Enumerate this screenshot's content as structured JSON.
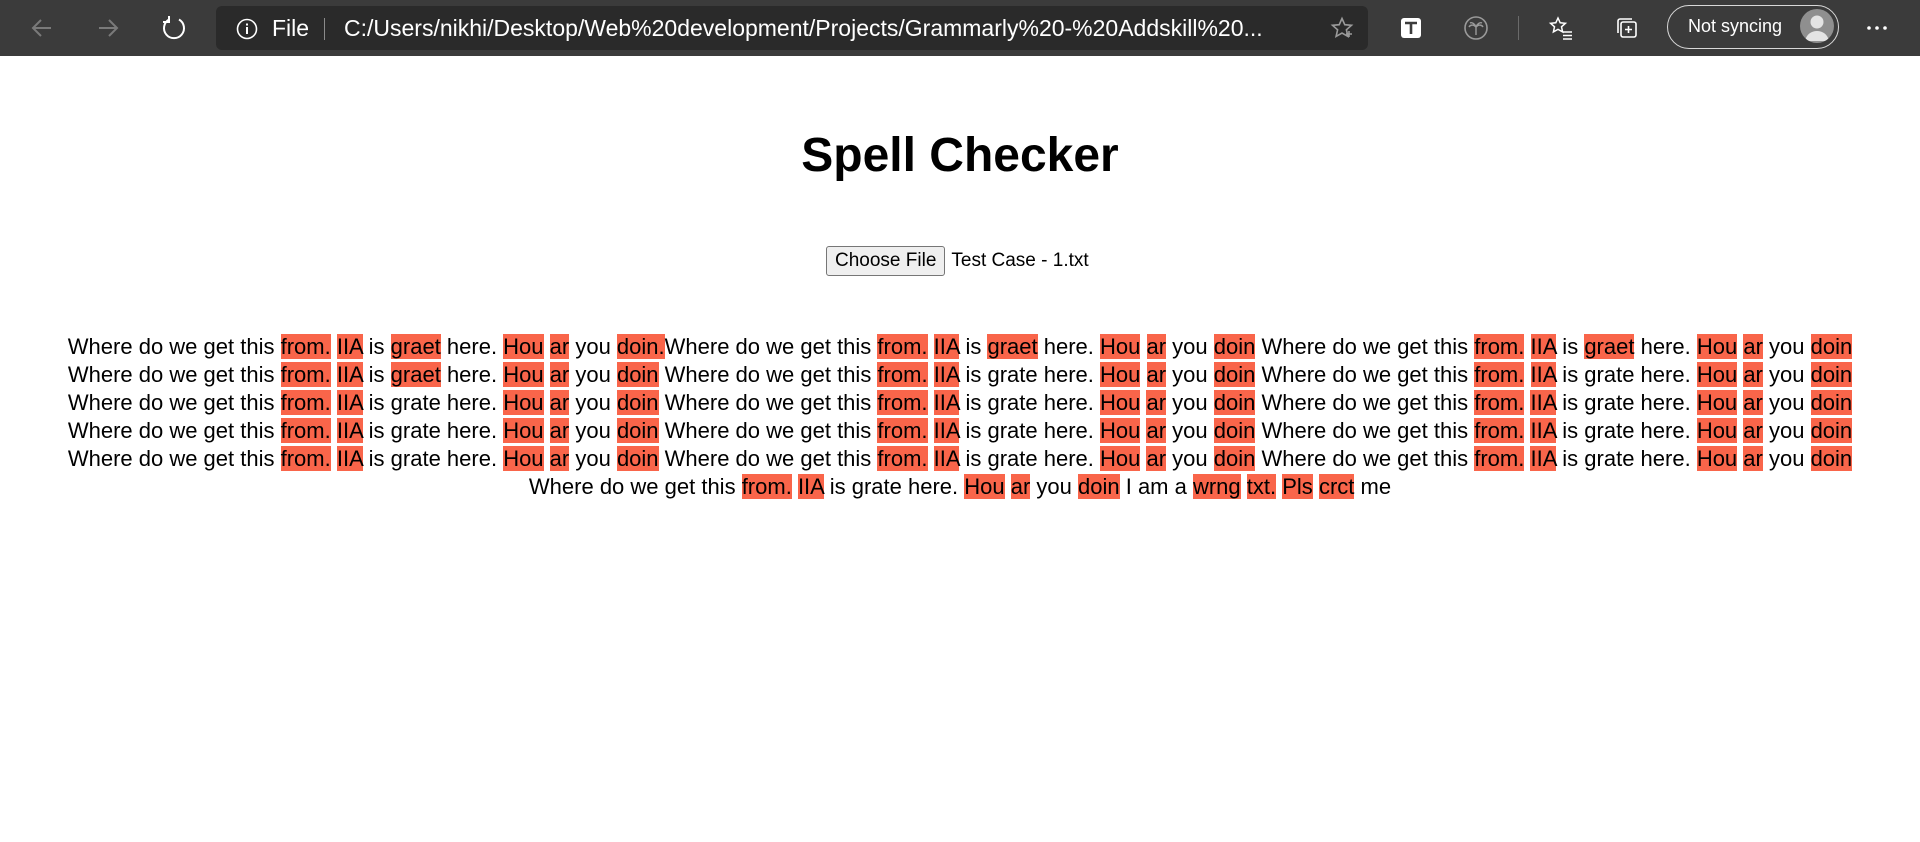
{
  "browser": {
    "address_scheme": "File",
    "url": "C:/Users/nikhi/Desktop/Web%20development/Projects/Grammarly%20-%20Addskill%20...",
    "sync_label": "Not syncing"
  },
  "page": {
    "title": "Spell Checker",
    "choose_file_label": "Choose File",
    "file_name": "Test Case - 1.txt"
  },
  "highlight_color": "#f9654a",
  "result_lines": [
    [
      [
        "Where do we get this ",
        false
      ],
      [
        "from.",
        true
      ],
      [
        " ",
        false
      ],
      [
        "IIA",
        true
      ],
      [
        " is ",
        false
      ],
      [
        "graet",
        true
      ],
      [
        " here. ",
        false
      ],
      [
        "Hou",
        true
      ],
      [
        " ",
        false
      ],
      [
        "ar",
        true
      ],
      [
        " you ",
        false
      ],
      [
        "doin.",
        true
      ],
      [
        "Where do we get this ",
        false
      ],
      [
        "from.",
        true
      ],
      [
        " ",
        false
      ],
      [
        "IIA",
        true
      ],
      [
        " is ",
        false
      ],
      [
        "graet",
        true
      ],
      [
        " here. ",
        false
      ],
      [
        "Hou",
        true
      ],
      [
        " ",
        false
      ],
      [
        "ar",
        true
      ],
      [
        " you ",
        false
      ],
      [
        "doin",
        true
      ],
      [
        " Where do we get this ",
        false
      ],
      [
        "from.",
        true
      ],
      [
        " ",
        false
      ],
      [
        "IIA",
        true
      ],
      [
        " is ",
        false
      ],
      [
        "graet",
        true
      ],
      [
        " here. ",
        false
      ],
      [
        "Hou",
        true
      ],
      [
        " ",
        false
      ],
      [
        "ar",
        true
      ],
      [
        " you ",
        false
      ],
      [
        "doin",
        true
      ]
    ],
    [
      [
        "Where do we get this ",
        false
      ],
      [
        "from.",
        true
      ],
      [
        " ",
        false
      ],
      [
        "IIA",
        true
      ],
      [
        " is ",
        false
      ],
      [
        "graet",
        true
      ],
      [
        " here. ",
        false
      ],
      [
        "Hou",
        true
      ],
      [
        " ",
        false
      ],
      [
        "ar",
        true
      ],
      [
        " you ",
        false
      ],
      [
        "doin",
        true
      ],
      [
        " Where do we get this ",
        false
      ],
      [
        "from.",
        true
      ],
      [
        " ",
        false
      ],
      [
        "IIA",
        true
      ],
      [
        " is grate here. ",
        false
      ],
      [
        "Hou",
        true
      ],
      [
        " ",
        false
      ],
      [
        "ar",
        true
      ],
      [
        " you ",
        false
      ],
      [
        "doin",
        true
      ],
      [
        " Where do we get this ",
        false
      ],
      [
        "from.",
        true
      ],
      [
        " ",
        false
      ],
      [
        "IIA",
        true
      ],
      [
        " is grate here. ",
        false
      ],
      [
        "Hou",
        true
      ],
      [
        " ",
        false
      ],
      [
        "ar",
        true
      ],
      [
        " you ",
        false
      ],
      [
        "doin",
        true
      ]
    ],
    [
      [
        "Where do we get this ",
        false
      ],
      [
        "from.",
        true
      ],
      [
        " ",
        false
      ],
      [
        "IIA",
        true
      ],
      [
        " is grate here. ",
        false
      ],
      [
        "Hou",
        true
      ],
      [
        " ",
        false
      ],
      [
        "ar",
        true
      ],
      [
        " you ",
        false
      ],
      [
        "doin",
        true
      ],
      [
        " Where do we get this ",
        false
      ],
      [
        "from.",
        true
      ],
      [
        " ",
        false
      ],
      [
        "IIA",
        true
      ],
      [
        " is grate here. ",
        false
      ],
      [
        "Hou",
        true
      ],
      [
        " ",
        false
      ],
      [
        "ar",
        true
      ],
      [
        " you ",
        false
      ],
      [
        "doin",
        true
      ],
      [
        " Where do we get this ",
        false
      ],
      [
        "from.",
        true
      ],
      [
        " ",
        false
      ],
      [
        "IIA",
        true
      ],
      [
        " is grate here. ",
        false
      ],
      [
        "Hou",
        true
      ],
      [
        " ",
        false
      ],
      [
        "ar",
        true
      ],
      [
        " you ",
        false
      ],
      [
        "doin",
        true
      ]
    ],
    [
      [
        "Where do we get this ",
        false
      ],
      [
        "from.",
        true
      ],
      [
        " ",
        false
      ],
      [
        "IIA",
        true
      ],
      [
        " is grate here. ",
        false
      ],
      [
        "Hou",
        true
      ],
      [
        " ",
        false
      ],
      [
        "ar",
        true
      ],
      [
        " you ",
        false
      ],
      [
        "doin",
        true
      ],
      [
        " Where do we get this ",
        false
      ],
      [
        "from.",
        true
      ],
      [
        " ",
        false
      ],
      [
        "IIA",
        true
      ],
      [
        " is grate here. ",
        false
      ],
      [
        "Hou",
        true
      ],
      [
        " ",
        false
      ],
      [
        "ar",
        true
      ],
      [
        " you ",
        false
      ],
      [
        "doin",
        true
      ],
      [
        " Where do we get this ",
        false
      ],
      [
        "from.",
        true
      ],
      [
        " ",
        false
      ],
      [
        "IIA",
        true
      ],
      [
        " is grate here. ",
        false
      ],
      [
        "Hou",
        true
      ],
      [
        " ",
        false
      ],
      [
        "ar",
        true
      ],
      [
        " you ",
        false
      ],
      [
        "doin",
        true
      ]
    ],
    [
      [
        "Where do we get this ",
        false
      ],
      [
        "from.",
        true
      ],
      [
        " ",
        false
      ],
      [
        "IIA",
        true
      ],
      [
        " is grate here. ",
        false
      ],
      [
        "Hou",
        true
      ],
      [
        " ",
        false
      ],
      [
        "ar",
        true
      ],
      [
        " you ",
        false
      ],
      [
        "doin",
        true
      ],
      [
        " Where do we get this ",
        false
      ],
      [
        "from.",
        true
      ],
      [
        " ",
        false
      ],
      [
        "IIA",
        true
      ],
      [
        " is grate here. ",
        false
      ],
      [
        "Hou",
        true
      ],
      [
        " ",
        false
      ],
      [
        "ar",
        true
      ],
      [
        " you ",
        false
      ],
      [
        "doin",
        true
      ],
      [
        " Where do we get this ",
        false
      ],
      [
        "from.",
        true
      ],
      [
        " ",
        false
      ],
      [
        "IIA",
        true
      ],
      [
        " is grate here. ",
        false
      ],
      [
        "Hou",
        true
      ],
      [
        " ",
        false
      ],
      [
        "ar",
        true
      ],
      [
        " you ",
        false
      ],
      [
        "doin",
        true
      ]
    ],
    [
      [
        "Where do we get this ",
        false
      ],
      [
        "from.",
        true
      ],
      [
        " ",
        false
      ],
      [
        "IIA",
        true
      ],
      [
        " is grate here. ",
        false
      ],
      [
        "Hou",
        true
      ],
      [
        " ",
        false
      ],
      [
        "ar",
        true
      ],
      [
        " you ",
        false
      ],
      [
        "doin",
        true
      ],
      [
        " I am a ",
        false
      ],
      [
        "wrng",
        true
      ],
      [
        " ",
        false
      ],
      [
        "txt.",
        true
      ],
      [
        " ",
        false
      ],
      [
        "Pls",
        true
      ],
      [
        " ",
        false
      ],
      [
        "crct",
        true
      ],
      [
        " me",
        false
      ]
    ]
  ]
}
